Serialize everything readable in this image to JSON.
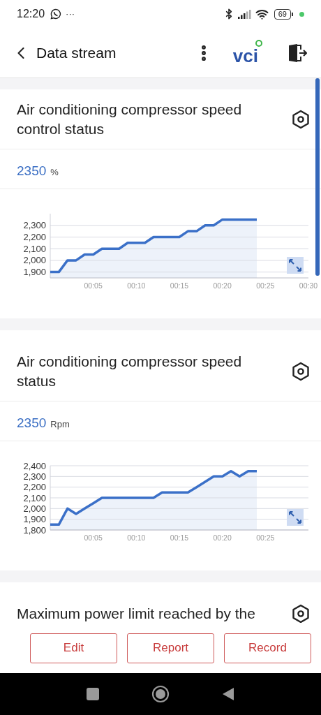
{
  "status_bar": {
    "time": "12:20",
    "more": "···",
    "battery": "69"
  },
  "header": {
    "title": "Data stream",
    "logo": "vci"
  },
  "cards": [
    {
      "title": "Air conditioning compressor speed control status",
      "value": "2350",
      "unit": "%",
      "chart_data": {
        "type": "area",
        "grid": true,
        "x": [
          0,
          1,
          2,
          3,
          4,
          5,
          6,
          7,
          8,
          9,
          10,
          11,
          12,
          13,
          14,
          15,
          16,
          17,
          18,
          19,
          20,
          21,
          22,
          23,
          24
        ],
        "values": [
          1900,
          1900,
          2000,
          2000,
          2050,
          2050,
          2100,
          2100,
          2100,
          2150,
          2150,
          2150,
          2200,
          2200,
          2200,
          2200,
          2250,
          2250,
          2300,
          2300,
          2350,
          2350,
          2350,
          2350,
          2350
        ],
        "xlim": [
          0,
          30
        ],
        "ylim": [
          1850,
          2400
        ],
        "yticks": [
          {
            "value": 1900,
            "label": "1,900"
          },
          {
            "value": 2000,
            "label": "2,000"
          },
          {
            "value": 2100,
            "label": "2,100"
          },
          {
            "value": 2200,
            "label": "2,200"
          },
          {
            "value": 2300,
            "label": "2,300"
          }
        ],
        "xticks": [
          {
            "value": 5,
            "label": "00:05"
          },
          {
            "value": 10,
            "label": "00:10"
          },
          {
            "value": 15,
            "label": "00:15"
          },
          {
            "value": 20,
            "label": "00:20"
          },
          {
            "value": 25,
            "label": "00:25"
          },
          {
            "value": 30,
            "label": "00:30"
          }
        ]
      }
    },
    {
      "title": "Air conditioning compressor speed status",
      "value": "2350",
      "unit": "Rpm",
      "chart_data": {
        "type": "area",
        "grid": true,
        "x": [
          0,
          1,
          2,
          3,
          4,
          5,
          6,
          7,
          8,
          9,
          10,
          11,
          12,
          13,
          14,
          15,
          16,
          17,
          18,
          19,
          20,
          21,
          22,
          23,
          24
        ],
        "values": [
          1850,
          1850,
          2000,
          1950,
          2000,
          2050,
          2100,
          2100,
          2100,
          2100,
          2100,
          2100,
          2100,
          2150,
          2150,
          2150,
          2150,
          2200,
          2250,
          2300,
          2300,
          2350,
          2300,
          2350,
          2350
        ],
        "xlim": [
          0,
          30
        ],
        "ylim": [
          1800,
          2400
        ],
        "yticks": [
          {
            "value": 1800,
            "label": "1,800"
          },
          {
            "value": 1900,
            "label": "1,900"
          },
          {
            "value": 2000,
            "label": "2,000"
          },
          {
            "value": 2100,
            "label": "2,100"
          },
          {
            "value": 2200,
            "label": "2,200"
          },
          {
            "value": 2300,
            "label": "2,300"
          },
          {
            "value": 2400,
            "label": "2,400"
          }
        ],
        "xticks": [
          {
            "value": 5,
            "label": "00:05"
          },
          {
            "value": 10,
            "label": "00:10"
          },
          {
            "value": 15,
            "label": "00:15"
          },
          {
            "value": 20,
            "label": "00:20"
          },
          {
            "value": 25,
            "label": "00:25"
          }
        ]
      }
    },
    {
      "title": "Maximum power limit reached by the"
    }
  ],
  "buttons": [
    "Edit",
    "Report",
    "Record"
  ]
}
